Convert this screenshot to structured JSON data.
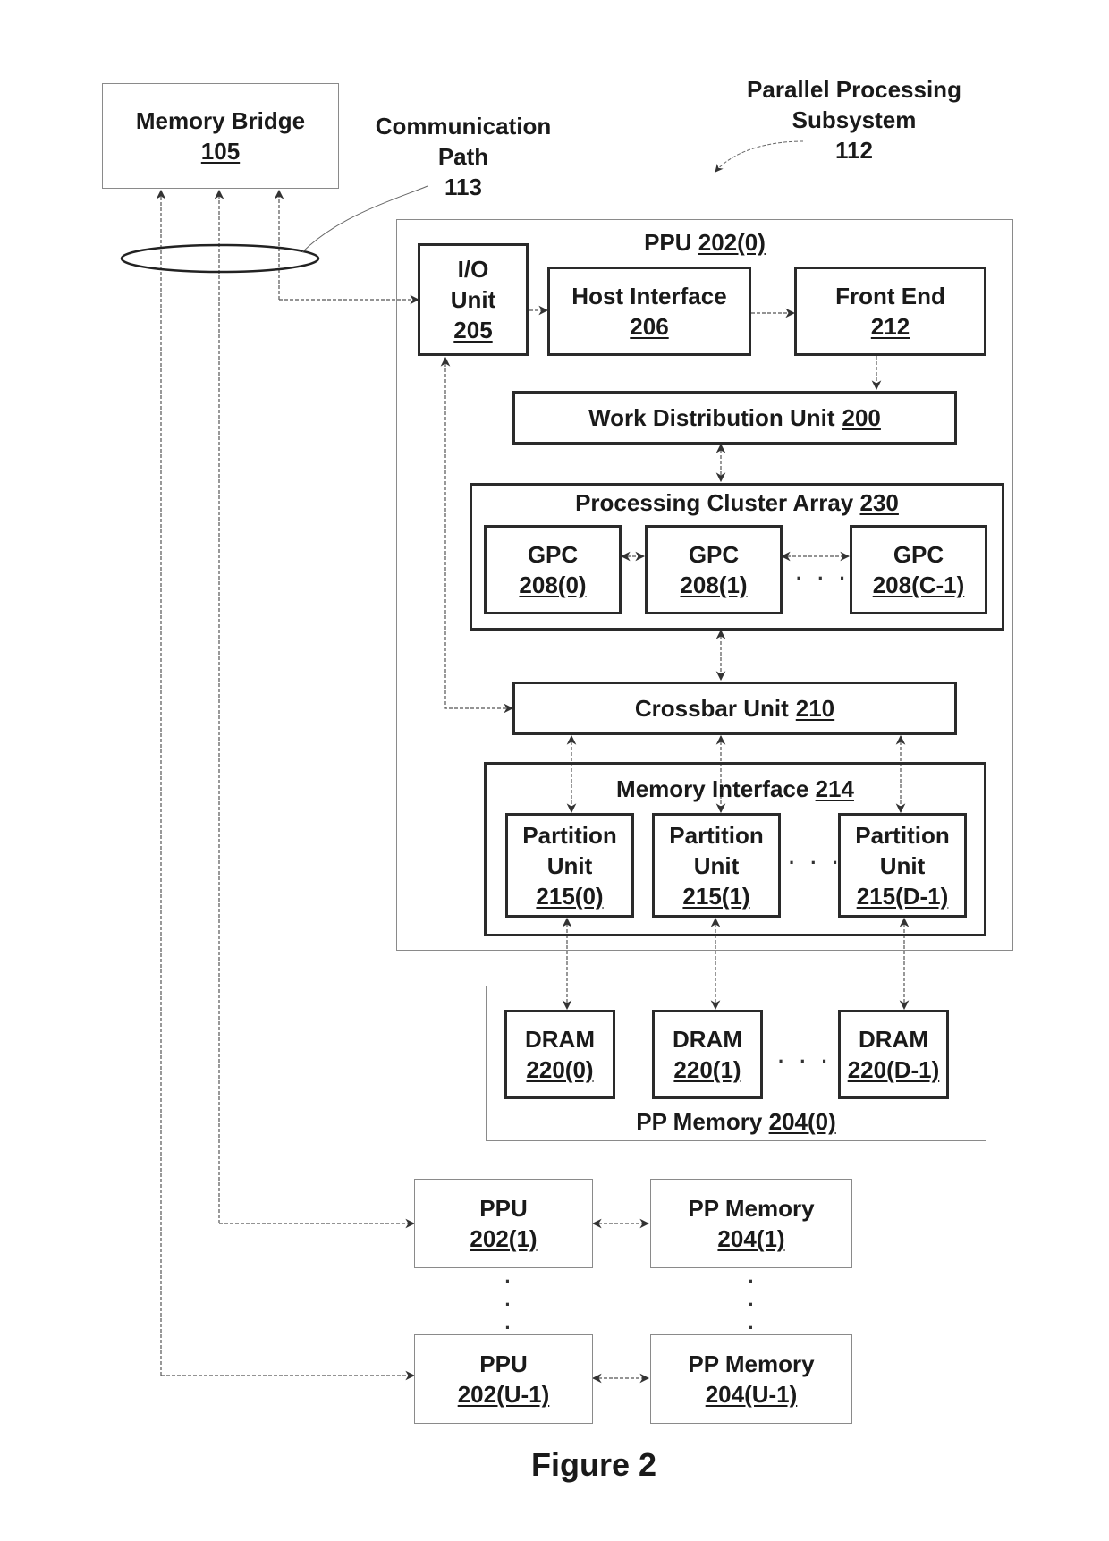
{
  "figure": {
    "caption": "Figure 2",
    "callouts": {
      "communication_path": {
        "line1": "Communication",
        "line2": "Path",
        "line3": "113"
      },
      "parallel_processing_subsystem": {
        "line1": "Parallel Processing",
        "line2": "Subsystem",
        "line3": "112"
      }
    },
    "memory_bridge": {
      "title": "Memory Bridge",
      "ref": "105"
    },
    "ppu0": {
      "title": "PPU",
      "ref": "202(0)",
      "io_unit": {
        "line1": "I/O",
        "line2": "Unit",
        "ref": "205"
      },
      "host_interface": {
        "title": "Host Interface",
        "ref": "206"
      },
      "front_end": {
        "title": "Front End",
        "ref": "212"
      },
      "work_distribution_unit": {
        "title": "Work Distribution Unit",
        "ref": "200"
      },
      "processing_cluster_array": {
        "title": "Processing Cluster Array",
        "ref": "230",
        "gpcs": [
          {
            "title": "GPC",
            "ref": "208(0)"
          },
          {
            "title": "GPC",
            "ref": "208(1)"
          },
          {
            "title": "GPC",
            "ref": "208(C-1)"
          }
        ],
        "ellipsis": ". . ."
      },
      "crossbar_unit": {
        "title": "Crossbar Unit",
        "ref": "210"
      },
      "memory_interface": {
        "title": "Memory Interface",
        "ref": "214",
        "partition_units": [
          {
            "line1": "Partition",
            "line2": "Unit",
            "ref": "215(0)"
          },
          {
            "line1": "Partition",
            "line2": "Unit",
            "ref": "215(1)"
          },
          {
            "line1": "Partition",
            "line2": "Unit",
            "ref": "215(D-1)"
          }
        ],
        "ellipsis": ". . ."
      }
    },
    "pp_memory0": {
      "title": "PP Memory",
      "ref": "204(0)",
      "drams": [
        {
          "title": "DRAM",
          "ref": "220(0)"
        },
        {
          "title": "DRAM",
          "ref": "220(1)"
        },
        {
          "title": "DRAM",
          "ref": "220(D-1)"
        }
      ],
      "ellipsis": ". . ."
    },
    "ppu1": {
      "title": "PPU",
      "ref": "202(1)"
    },
    "pp_memory1": {
      "title": "PP Memory",
      "ref": "204(1)"
    },
    "ppu_last": {
      "title": "PPU",
      "ref": "202(U-1)"
    },
    "pp_memory_last": {
      "title": "PP Memory",
      "ref": "204(U-1)"
    },
    "vertical_ellipsis": "·\n·\n·"
  }
}
